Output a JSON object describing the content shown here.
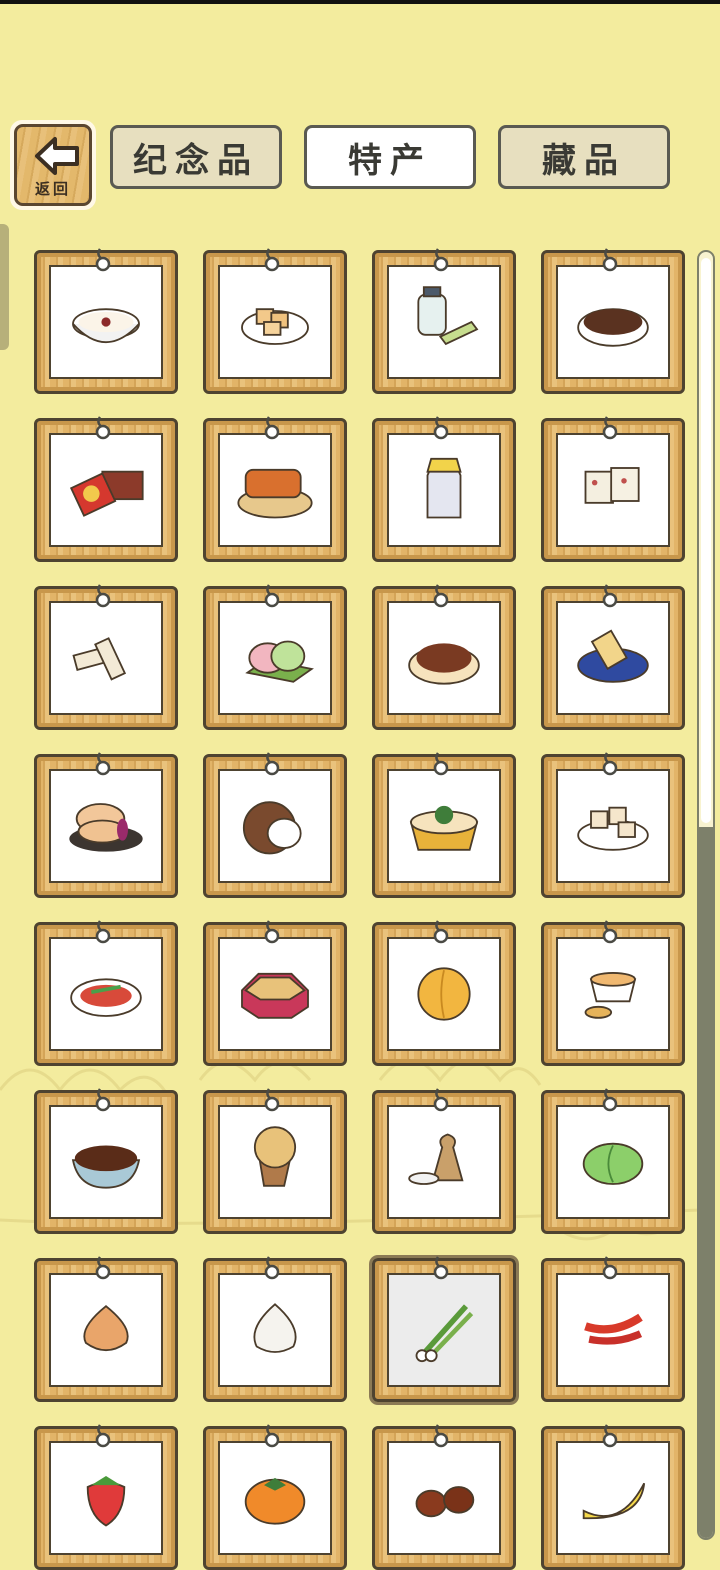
{
  "back_button": {
    "label": "返回",
    "icon": "back-arrow-icon"
  },
  "tabs": [
    {
      "label": "纪念品",
      "active": false
    },
    {
      "label": "特产",
      "active": true
    },
    {
      "label": "藏品",
      "active": false
    }
  ],
  "colors": {
    "background": "#f3ec9e",
    "card_wood": "#e2b468",
    "tab_active": "#ffffff",
    "tab_inactive": "#e7dfbf"
  },
  "items": [
    {
      "icon": "rice-porridge-icon"
    },
    {
      "icon": "tofu-plate-icon"
    },
    {
      "icon": "tea-jar-icon"
    },
    {
      "icon": "coffee-beans-icon"
    },
    {
      "icon": "gift-box-icon"
    },
    {
      "icon": "fried-dough-twist-icon"
    },
    {
      "icon": "liquor-bottle-icon"
    },
    {
      "icon": "nougat-cake-icon"
    },
    {
      "icon": "sesame-candy-icon"
    },
    {
      "icon": "mochi-icon"
    },
    {
      "icon": "braised-nuts-icon"
    },
    {
      "icon": "ice-pop-icon"
    },
    {
      "icon": "flower-pastry-icon"
    },
    {
      "icon": "coconut-icon"
    },
    {
      "icon": "noodle-bowl-icon"
    },
    {
      "icon": "tofu-cubes-icon"
    },
    {
      "icon": "salad-plate-icon"
    },
    {
      "icon": "snack-box-icon"
    },
    {
      "icon": "apricot-icon"
    },
    {
      "icon": "tea-cup-ginger-icon"
    },
    {
      "icon": "chestnut-bowl-icon"
    },
    {
      "icon": "peanut-cone-icon"
    },
    {
      "icon": "rice-sack-icon"
    },
    {
      "icon": "cabbage-icon"
    },
    {
      "icon": "onion-icon"
    },
    {
      "icon": "garlic-icon"
    },
    {
      "icon": "green-onion-icon",
      "selected": true
    },
    {
      "icon": "chili-pepper-icon"
    },
    {
      "icon": "strawberry-icon"
    },
    {
      "icon": "persimmon-icon"
    },
    {
      "icon": "chestnuts-icon"
    },
    {
      "icon": "banana-icon"
    }
  ]
}
